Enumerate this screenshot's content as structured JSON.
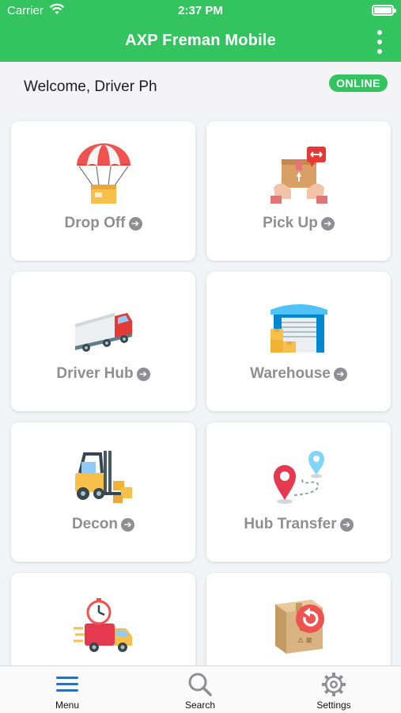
{
  "status_bar": {
    "carrier": "Carrier",
    "time": "2:37 PM"
  },
  "header": {
    "title": "AXP Freman Mobile"
  },
  "welcome": {
    "text": "Welcome, Driver Ph",
    "status_badge": "ONLINE"
  },
  "menu": [
    {
      "label": "Drop Off",
      "icon": "parachute-box-icon"
    },
    {
      "label": "Pick Up",
      "icon": "hands-package-icon"
    },
    {
      "label": "Driver Hub",
      "icon": "truck-icon"
    },
    {
      "label": "Warehouse",
      "icon": "warehouse-icon"
    },
    {
      "label": "Decon",
      "icon": "forklift-icon"
    },
    {
      "label": "Hub Transfer",
      "icon": "route-pins-icon"
    },
    {
      "label": "",
      "icon": "fast-delivery-truck-icon"
    },
    {
      "label": "",
      "icon": "return-package-icon"
    }
  ],
  "tabbar": {
    "menu_label": "Menu",
    "search_label": "Search",
    "settings_label": "Settings"
  },
  "colors": {
    "brand_green": "#33c45f",
    "label_gray": "#8e8e93"
  }
}
